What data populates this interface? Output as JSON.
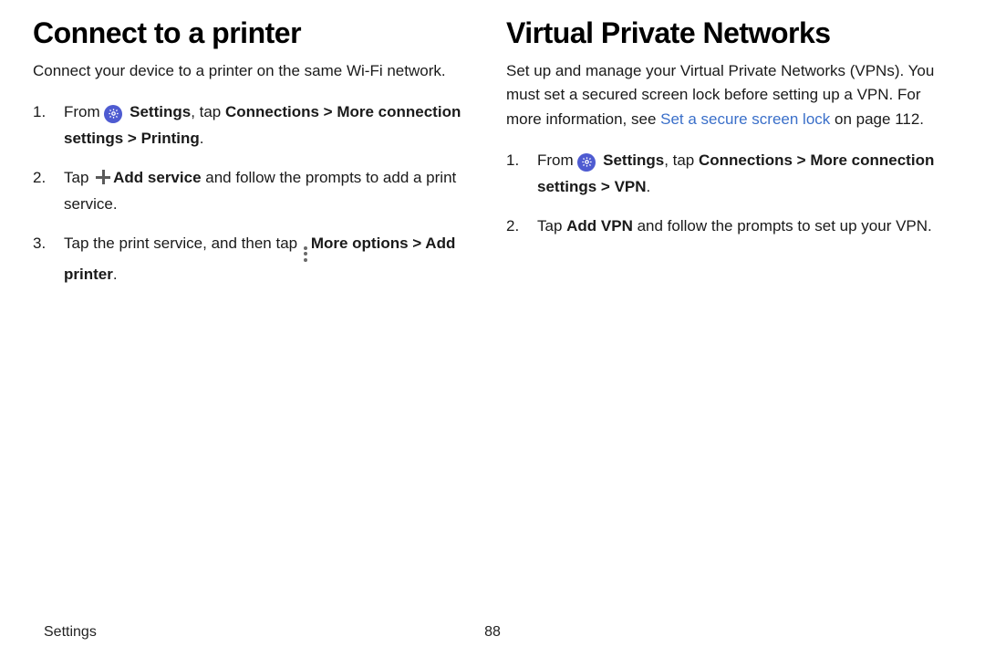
{
  "left": {
    "title": "Connect to a printer",
    "intro": "Connect your device to a printer on the same Wi-Fi network.",
    "step1": {
      "from": "From ",
      "settings": "Settings",
      "tap": ", tap ",
      "connections": "Connections",
      "sep1": " > ",
      "more": "More connection settings",
      "sep2": " > ",
      "printing": "Printing",
      "dot": "."
    },
    "step2": {
      "tap": "Tap ",
      "add": "Add service",
      "rest": " and follow the prompts to add a print service."
    },
    "step3": {
      "a": "Tap the print service, and then tap ",
      "more": "More options",
      "sep": " > ",
      "addp": "Add printer",
      "dot": "."
    }
  },
  "right": {
    "title": "Virtual Private Networks",
    "intro_a": "Set up and manage your Virtual Private Networks (VPNs). You must set a secured screen lock before setting up a VPN. For more information, see ",
    "intro_link": "Set a secure screen lock",
    "intro_b": " on page 112.",
    "step1": {
      "from": "From ",
      "settings": "Settings",
      "tap": ", tap ",
      "connections": "Connections",
      "sep1": " > ",
      "more": "More connection settings",
      "sep2": " > ",
      "vpn": "VPN",
      "dot": "."
    },
    "step2": {
      "a": "Tap ",
      "add": "Add VPN",
      "b": " and follow the prompts to set up your VPN."
    }
  },
  "footer": {
    "section": "Settings",
    "page": "88"
  }
}
